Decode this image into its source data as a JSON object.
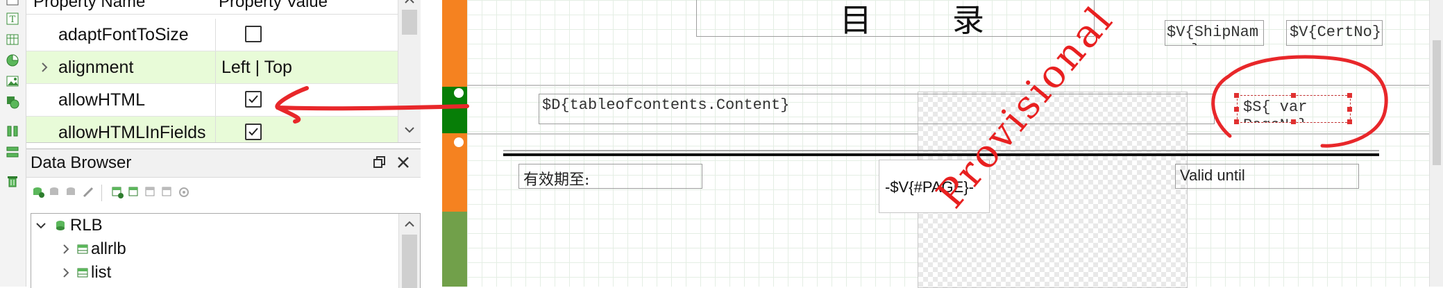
{
  "property_grid": {
    "header_name": "Property Name",
    "header_value": "Property Value",
    "rows": [
      {
        "name": "adaptFontToSize",
        "value": "",
        "checked": false,
        "highlighted": false
      },
      {
        "name": "alignment",
        "value": "Left | Top",
        "highlighted": true,
        "expandable": true
      },
      {
        "name": "allowHTML",
        "value": "",
        "checked": true,
        "highlighted": false
      },
      {
        "name": "allowHTMLInFields",
        "value": "",
        "checked": true,
        "highlighted": true
      }
    ]
  },
  "data_browser": {
    "title": "Data Browser",
    "tree": {
      "root": "RLB",
      "children": [
        "allrlb",
        "list"
      ]
    }
  },
  "report": {
    "title_chars": "目　　录",
    "ship_name_field": "$V{ShipNam",
    "ship_name_overflow": "e}",
    "cert_no_field": "$V{CertNo}",
    "content_field": "$D{tableofcontents.Content}",
    "var_field": "$S{ var",
    "var_field_overflow": "PageNo}",
    "valid_until_cn": "有效期至:",
    "page_field": "-$V{#PAGE}-",
    "valid_until_en": "Valid until",
    "watermark": "Provisional"
  },
  "colors": {
    "highlight_row": "#e8fbd8",
    "band_orange": "#f58220",
    "band_green": "#71a04a",
    "band_dark_green": "#077e07",
    "annotation_red": "#e8272a",
    "watermark_red": "#e82020"
  }
}
